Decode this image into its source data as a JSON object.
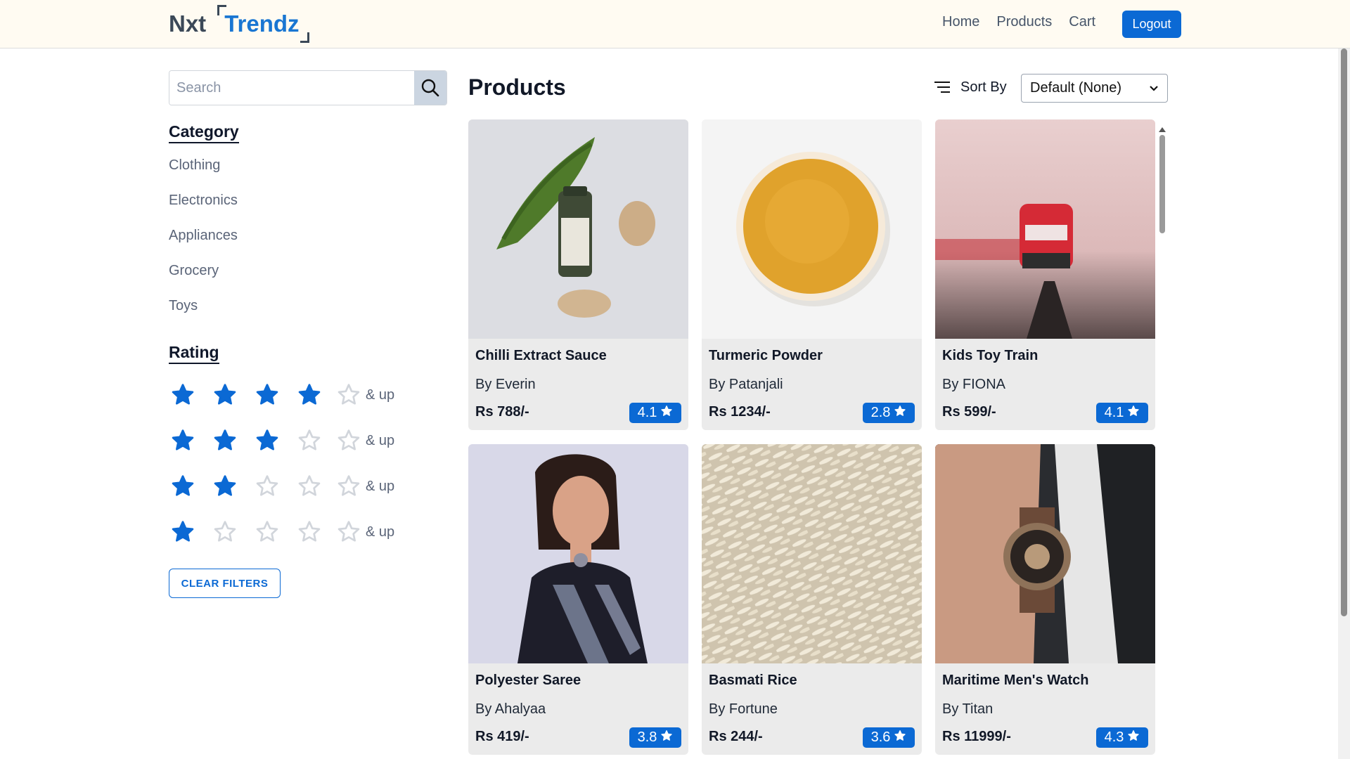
{
  "header": {
    "logo_part1": "Nxt",
    "logo_part2": "Trendz",
    "nav": [
      "Home",
      "Products",
      "Cart"
    ],
    "logout_label": "Logout"
  },
  "sidebar": {
    "search_placeholder": "Search",
    "category_title": "Category",
    "categories": [
      "Clothing",
      "Electronics",
      "Appliances",
      "Grocery",
      "Toys"
    ],
    "rating_title": "Rating",
    "rating_filters": [
      {
        "filled": 4,
        "label": "& up"
      },
      {
        "filled": 3,
        "label": "& up"
      },
      {
        "filled": 2,
        "label": "& up"
      },
      {
        "filled": 1,
        "label": "& up"
      }
    ],
    "clear_label": "CLEAR FILTERS"
  },
  "main": {
    "title": "Products",
    "sort_label": "Sort By",
    "sort_value": "Default (None)",
    "products": [
      {
        "title": "Chilli Extract Sauce",
        "brand": "By Everin",
        "price": "Rs 788/-",
        "rating": "4.1"
      },
      {
        "title": "Turmeric Powder",
        "brand": "By Patanjali",
        "price": "Rs 1234/-",
        "rating": "2.8"
      },
      {
        "title": "Kids Toy Train",
        "brand": "By FIONA",
        "price": "Rs 599/-",
        "rating": "4.1"
      },
      {
        "title": "Polyester Saree",
        "brand": "By Ahalyaa",
        "price": "Rs 419/-",
        "rating": "3.8"
      },
      {
        "title": "Basmati Rice",
        "brand": "By Fortune",
        "price": "Rs 244/-",
        "rating": "3.6"
      },
      {
        "title": "Maritime Men's Watch",
        "brand": "By Titan",
        "price": "Rs 11999/-",
        "rating": "4.3"
      }
    ]
  },
  "colors": {
    "accent": "#0b69d4",
    "navbar_bg": "#fffbf2",
    "card_bg": "#ebebeb",
    "star_filled": "#0b69d4",
    "star_empty": "#e5e7eb"
  }
}
